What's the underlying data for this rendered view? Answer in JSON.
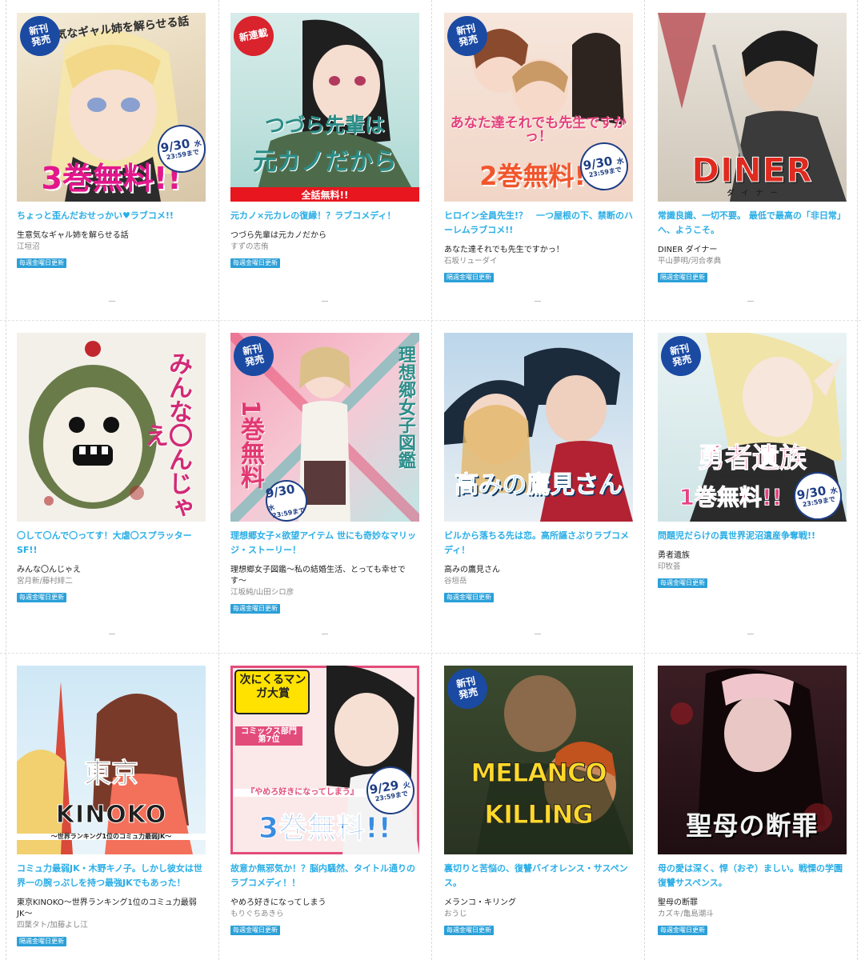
{
  "cards": [
    {
      "tagline": "ちょっと歪んだおせっかい♥ラブコメ!!",
      "title": "生意気なギャル姉を解らせる話",
      "author": "江垣沼",
      "update": "毎週金曜日更新",
      "badge": "新刊 発売",
      "cover_text": "3巻無料!!",
      "cover_subtext": "生意気なギャル姉を解らせる話",
      "date": "9/30",
      "date_day": "水",
      "date_time": "23:59まで"
    },
    {
      "tagline": "元カノ×元カレの復縁！？ラブコメディ！",
      "title": "つづら先輩は元カノだから",
      "author": "すずの志侑",
      "update": "毎週金曜日更新",
      "badge": "新連載",
      "cover_text": "つづら先輩は",
      "cover_subtext": "元カノだから",
      "band": "全話無料!!"
    },
    {
      "tagline": "ヒロイン全員先生!？　一つ屋根の下、禁断のハーレムラブコメ!!",
      "title": "あなた達それでも先生ですかっ！",
      "author": "石坂リューダイ",
      "update": "隔週金曜日更新",
      "badge": "新刊 発売",
      "cover_text": "2巻無料!!",
      "cover_subtext": "あなた達それでも先生ですかっ！",
      "date": "9/30",
      "date_day": "水",
      "date_time": "23:59まで"
    },
    {
      "tagline": "常識良識、一切不要。 最低で最高の「非日常」へ、ようこそ。",
      "title": "DINER ダイナー",
      "author": "平山夢明/河合孝典",
      "update": "隔週金曜日更新",
      "cover_text": "DINER",
      "cover_subtext": "ダ　イ　ナ　ー"
    },
    {
      "tagline": "〇して〇んで〇ってす！大虐〇スプラッターSF!!",
      "title": "みんな〇んじゃえ",
      "author": "宮月新/藤村緋二",
      "update": "毎週金曜日更新",
      "cover_text": "みんな〇んじゃえ"
    },
    {
      "tagline": "理想郷女子×欲望アイテム 世にも奇妙なマリッジ・ストーリー！",
      "title": "理想郷女子図鑑〜私の結婚生活、とっても幸せです〜",
      "author": "江坂純/山田シロ彦",
      "update": "毎週金曜日更新",
      "badge": "新刊 発売",
      "cover_text": "1巻無料",
      "cover_subtext": "理想郷女子図鑑",
      "date": "9/30",
      "date_day": "水",
      "date_time": "23:59まで"
    },
    {
      "tagline": "ビルから落ちる先は恋。高所謳さぶりラブコメディ！",
      "title": "高みの鷹見さん",
      "author": "谷垣岳",
      "update": "毎週金曜日更新",
      "cover_text": "高みの鷹見さん"
    },
    {
      "tagline": "問題児だらけの異世界泥沼遺産争奪戦!!",
      "title": "勇者遺族",
      "author": "印牧荟",
      "update": "毎週金曜日更新",
      "badge": "新刊 発売",
      "cover_text": "1巻無料!!",
      "cover_subtext": "勇者遺族",
      "cover_subtext2": "BEREAVED FAMILY",
      "date": "9/30",
      "date_day": "水",
      "date_time": "23:59まで"
    },
    {
      "tagline": "コミュ力最弱JK・木野キノ子。しかし彼女は世界一の腕っぷしを持つ最強JKでもあった！",
      "title": "東京KINOKO〜世界ランキング1位のコミュ力最弱JK〜",
      "author": "四葉タト/加藤よし江",
      "update": "隔週金曜日更新",
      "cover_text": "東京",
      "cover_subtext": "KINOKO",
      "cover_subtext2": "〜世界ランキング1位のコミュ力最弱JK〜"
    },
    {
      "tagline": "故意か無邪気か！？脳内騒然、タイトル通りのラブコメディ！！",
      "title": "やめろ好きになってしまう",
      "author": "もりぐちあきら",
      "update": "毎週金曜日更新",
      "cover_text": "3巻無料!!",
      "cover_subtext": "『やめろ好きになってしまう』",
      "cover_subtext2": "次にくるマンガ大賞",
      "cover_subtext3": "コミックス部門 第7位",
      "date": "9/29",
      "date_day": "火",
      "date_time": "23:59まで"
    },
    {
      "tagline": "裏切りと苦悩の、復讐バイオレンス・サスペンス。",
      "title": "メランコ・キリング",
      "author": "おうじ",
      "update": "毎週金曜日更新",
      "badge": "新刊 発売",
      "cover_text": "MELANCO",
      "cover_subtext": "KILLING"
    },
    {
      "tagline": "母の愛は深く、悍（おぞ）ましい。戦慄の学園復讐サスペンス。",
      "title": "聖母の断罪",
      "author": "カズキ/亀島潮斗",
      "update": "毎週金曜日更新",
      "cover_text": "聖母の断罪"
    }
  ]
}
